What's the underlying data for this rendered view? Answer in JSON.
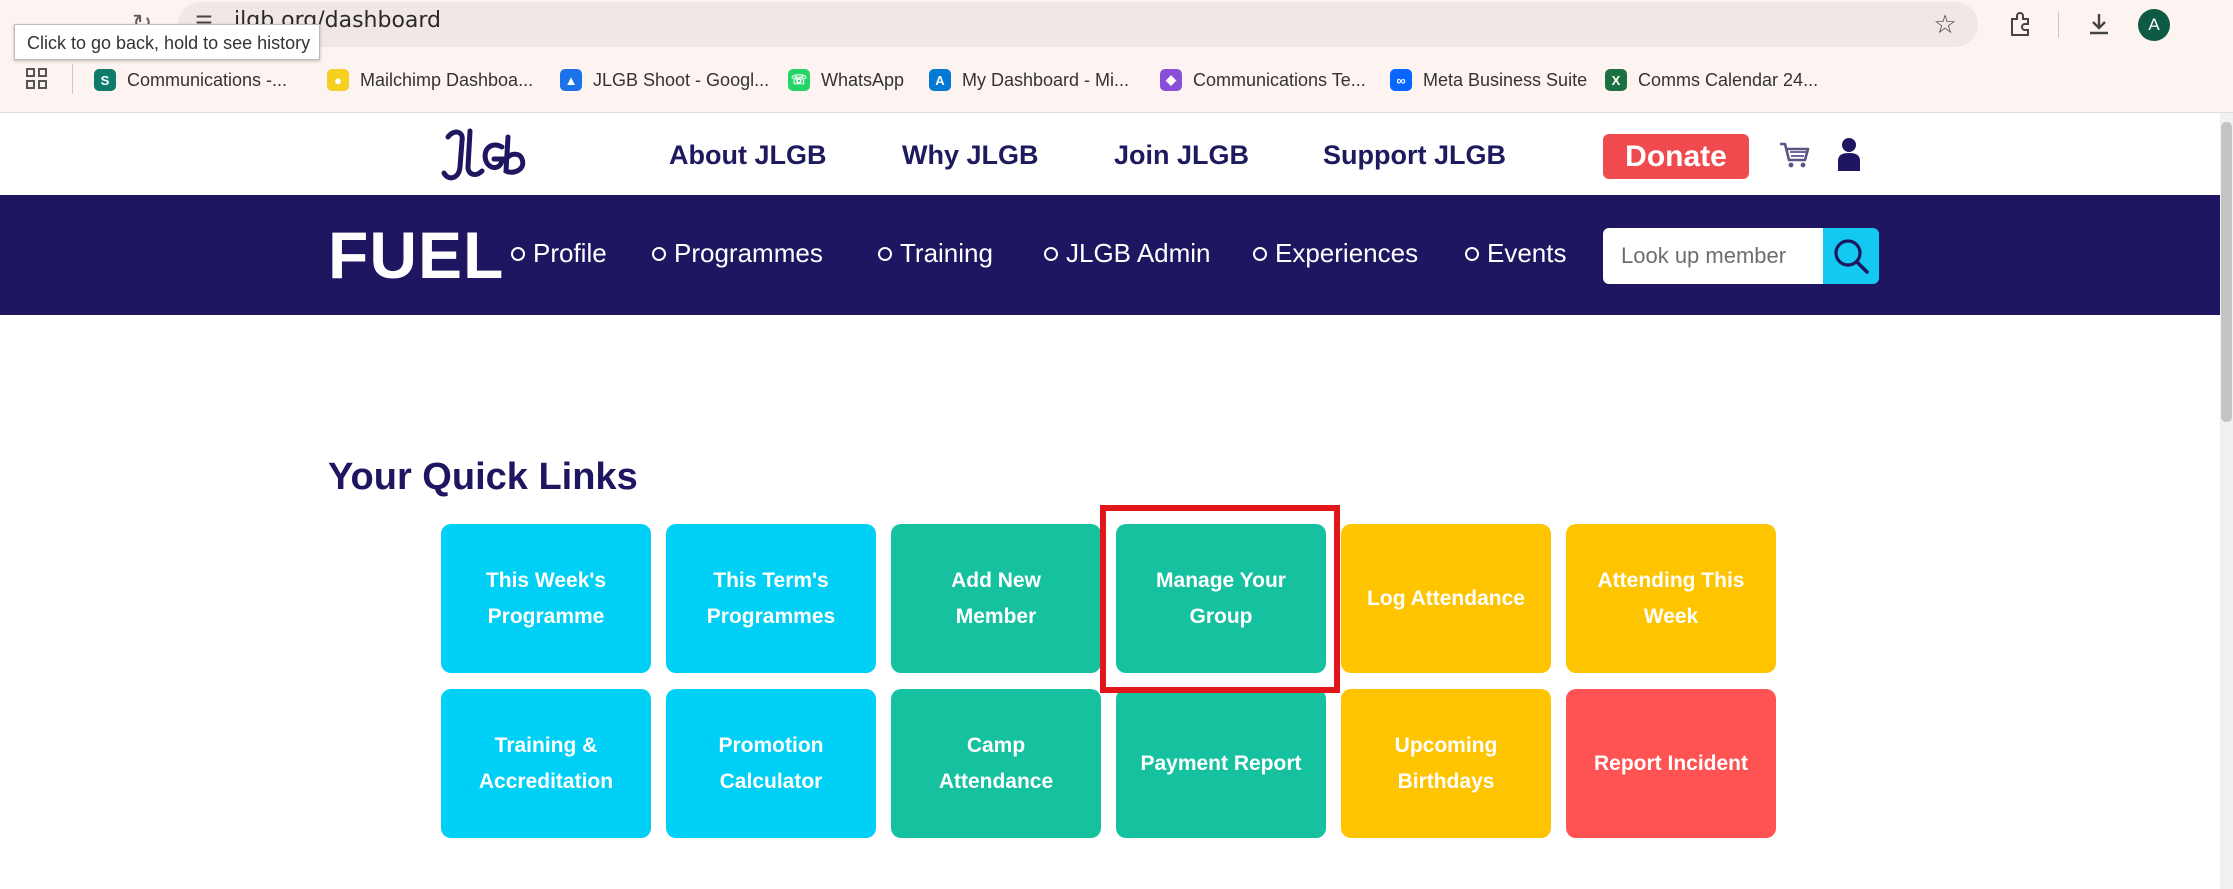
{
  "browser": {
    "url": "jlgb.org/dashboard",
    "tooltip": "Click to go back, hold to see history",
    "profile_initial": "A",
    "bookmarks": [
      {
        "label": "Communications -...",
        "icon": "sharepoint-icon",
        "color": "#0f7b6c"
      },
      {
        "label": "Mailchimp Dashboa...",
        "icon": "mailchimp-icon",
        "color": "#f5d020"
      },
      {
        "label": "JLGB Shoot - Googl...",
        "icon": "google-drive-icon",
        "color": "#1a73e8"
      },
      {
        "label": "WhatsApp",
        "icon": "whatsapp-icon",
        "color": "#25d366"
      },
      {
        "label": "My Dashboard - Mi...",
        "icon": "azure-icon",
        "color": "#0078d4"
      },
      {
        "label": "Communications Te...",
        "icon": "teams-icon",
        "color": "#8a4fd8"
      },
      {
        "label": "Meta Business Suite",
        "icon": "meta-icon",
        "color": "#0866ff"
      },
      {
        "label": "Comms Calendar 24...",
        "icon": "excel-icon",
        "color": "#1d7044"
      }
    ]
  },
  "site": {
    "nav": [
      "About JLGB",
      "Why JLGB",
      "Join JLGB",
      "Support JLGB"
    ],
    "donate_label": "Donate",
    "brand_color": "#1e1660",
    "donate_color": "#ef4b4f"
  },
  "fuel": {
    "title": "FUEL",
    "nav": [
      "Profile",
      "Programmes",
      "Training",
      "JLGB Admin",
      "Experiences",
      "Events"
    ],
    "search_placeholder": "Look up member"
  },
  "quick_links": {
    "heading": "Your Quick Links",
    "rows": [
      [
        {
          "label": "This Week's Programme",
          "color": "#00d0f5"
        },
        {
          "label": "This Term's Programmes",
          "color": "#00d0f5"
        },
        {
          "label": "Add New Member",
          "color": "#16c1a0"
        },
        {
          "label": "Manage Your Group",
          "color": "#16c1a0"
        },
        {
          "label": "Log Attendance",
          "color": "#ffc400"
        },
        {
          "label": "Attending This Week",
          "color": "#ffc400"
        }
      ],
      [
        {
          "label": "Training & Accreditation",
          "color": "#00d0f5"
        },
        {
          "label": "Promotion Calculator",
          "color": "#00d0f5"
        },
        {
          "label": "Camp Attendance",
          "color": "#16c1a0"
        },
        {
          "label": "Payment Report",
          "color": "#16c1a0"
        },
        {
          "label": "Upcoming Birthdays",
          "color": "#ffc400"
        },
        {
          "label": "Report Incident",
          "color": "#ff5252"
        }
      ]
    ]
  }
}
